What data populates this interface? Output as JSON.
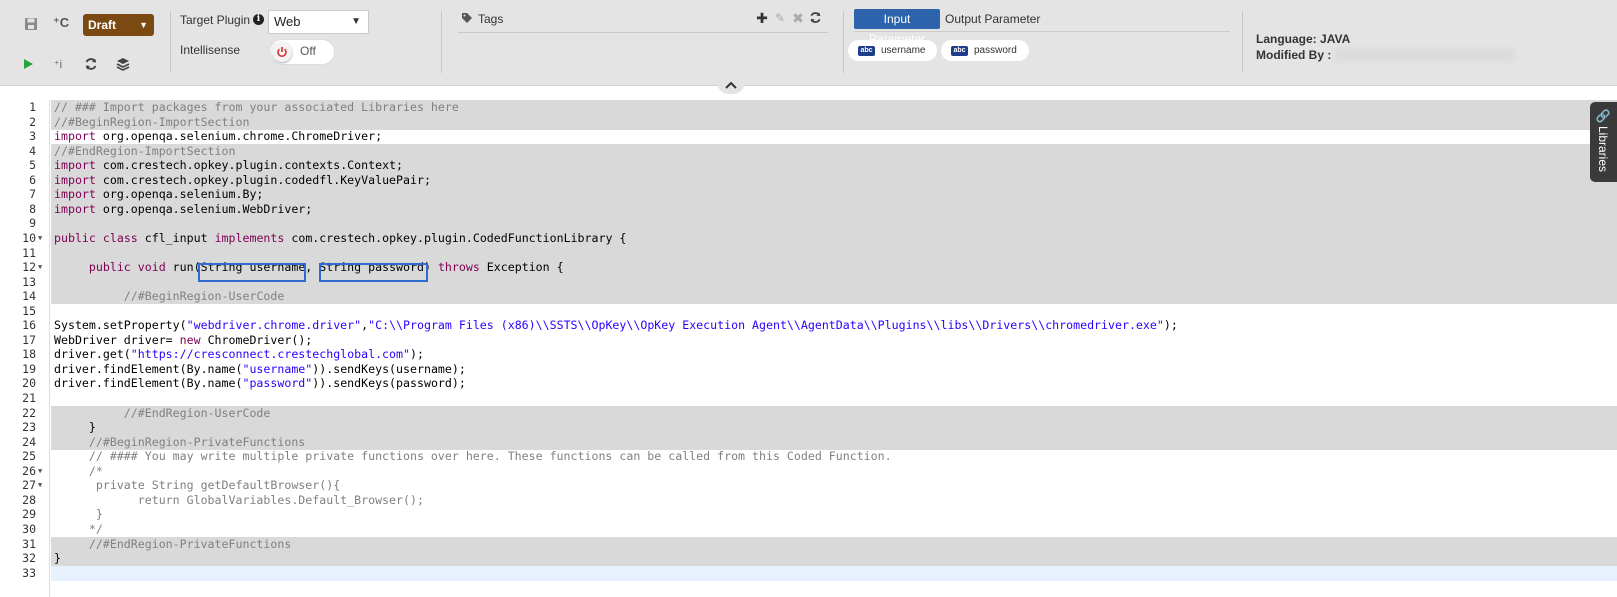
{
  "toolbar": {
    "status": "Draft",
    "target_plugin_label": "Target Plugin",
    "target_plugin_value": "Web",
    "intellisense_label": "Intellisense",
    "intellisense_state": "Off",
    "tags_label": "Tags",
    "tabs": {
      "input": "Input Parameter",
      "output": "Output Parameter"
    },
    "params": [
      {
        "type_badge": "abc",
        "name": "username"
      },
      {
        "type_badge": "abc",
        "name": "password"
      }
    ],
    "language_label": "Language:",
    "language_value": "JAVA",
    "modified_by_label": "Modified By :",
    "icons": [
      "save-icon",
      "add-coded-function-icon",
      "run-icon",
      "add-input-icon",
      "refresh-icon",
      "stack-icon",
      "info-icon",
      "power-icon",
      "tag-icon",
      "plus-icon",
      "edit-icon",
      "delete-icon",
      "sync-icon",
      "chevron-up-icon",
      "link-icon"
    ]
  },
  "libraries_tab": "Libraries",
  "colors": {
    "status_draft": "#7a4a12",
    "tab_active": "#2d62ad",
    "locked_region": "#d9d9d9",
    "highlight_border": "#2f6bd3"
  },
  "code_lines": [
    {
      "n": "1",
      "text": "// ### Import packages from your associated Libraries here",
      "cls": "t-comment",
      "lock": true
    },
    {
      "n": "2",
      "text": "//#BeginRegion-ImportSection",
      "cls": "t-comment",
      "lock": true
    },
    {
      "n": "3",
      "text": "import org.openqa.selenium.chrome.ChromeDriver;",
      "cls": "",
      "lock": false,
      "kw": "import"
    },
    {
      "n": "4",
      "text": "//#EndRegion-ImportSection",
      "cls": "t-comment",
      "lock": true
    },
    {
      "n": "5",
      "text": "import com.crestech.opkey.plugin.contexts.Context;",
      "cls": "",
      "lock": true,
      "kw": "import"
    },
    {
      "n": "6",
      "text": "import com.crestech.opkey.plugin.codedfl.KeyValuePair;",
      "cls": "",
      "lock": true,
      "kw": "import"
    },
    {
      "n": "7",
      "text": "import org.openqa.selenium.By;",
      "cls": "",
      "lock": true,
      "kw": "import"
    },
    {
      "n": "8",
      "text": "import org.openqa.selenium.WebDriver;",
      "cls": "",
      "lock": true,
      "kw": "import"
    },
    {
      "n": "9",
      "text": "",
      "cls": "",
      "lock": true
    },
    {
      "n": "10",
      "text": "public class cfl_input implements com.crestech.opkey.plugin.CodedFunctionLibrary {",
      "cls": "",
      "lock": true,
      "fold": true
    },
    {
      "n": "11",
      "text": "",
      "cls": "",
      "lock": true
    },
    {
      "n": "12",
      "text": "     public void run(String username, String password) throws Exception {",
      "cls": "",
      "lock": true,
      "fold": true
    },
    {
      "n": "13",
      "text": "",
      "cls": "",
      "lock": true
    },
    {
      "n": "14",
      "text": "          //#BeginRegion-UserCode",
      "cls": "t-comment",
      "lock": true
    },
    {
      "n": "15",
      "text": "",
      "cls": "",
      "lock": false
    },
    {
      "n": "16",
      "text": "System.setProperty(\"webdriver.chrome.driver\",\"C:\\\\Program Files (x86)\\\\SSTS\\\\OpKey\\\\OpKey Execution Agent\\\\AgentData\\\\Plugins\\\\libs\\\\Drivers\\\\chromedriver.exe\");",
      "cls": "",
      "lock": false
    },
    {
      "n": "17",
      "text": "WebDriver driver= new ChromeDriver();",
      "cls": "",
      "lock": false
    },
    {
      "n": "18",
      "text": "driver.get(\"https://cresconnect.crestechglobal.com\");",
      "cls": "",
      "lock": false
    },
    {
      "n": "19",
      "text": "driver.findElement(By.name(\"username\")).sendKeys(username);",
      "cls": "",
      "lock": false
    },
    {
      "n": "20",
      "text": "driver.findElement(By.name(\"password\")).sendKeys(password);",
      "cls": "",
      "lock": false
    },
    {
      "n": "21",
      "text": "",
      "cls": "",
      "lock": false
    },
    {
      "n": "22",
      "text": "          //#EndRegion-UserCode",
      "cls": "t-comment",
      "lock": true
    },
    {
      "n": "23",
      "text": "     }",
      "cls": "",
      "lock": true
    },
    {
      "n": "24",
      "text": "     //#BeginRegion-PrivateFunctions",
      "cls": "t-comment",
      "lock": true
    },
    {
      "n": "25",
      "text": "     // #### You may write multiple private functions over here. These functions can be called from this Coded Function.",
      "cls": "t-comment",
      "lock": false
    },
    {
      "n": "26",
      "text": "     /*",
      "cls": "t-comment",
      "lock": false,
      "fold": true
    },
    {
      "n": "27",
      "text": "      private String getDefaultBrowser(){",
      "cls": "t-comment",
      "lock": false,
      "fold": true
    },
    {
      "n": "28",
      "text": "            return GlobalVariables.Default_Browser();",
      "cls": "t-comment",
      "lock": false
    },
    {
      "n": "29",
      "text": "      }",
      "cls": "t-comment",
      "lock": false
    },
    {
      "n": "30",
      "text": "     */",
      "cls": "t-comment",
      "lock": false
    },
    {
      "n": "31",
      "text": "     //#EndRegion-PrivateFunctions",
      "cls": "t-comment",
      "lock": true
    },
    {
      "n": "32",
      "text": "}",
      "cls": "",
      "lock": true
    },
    {
      "n": "33",
      "text": "",
      "cls": "",
      "lock": false,
      "active": true
    }
  ]
}
